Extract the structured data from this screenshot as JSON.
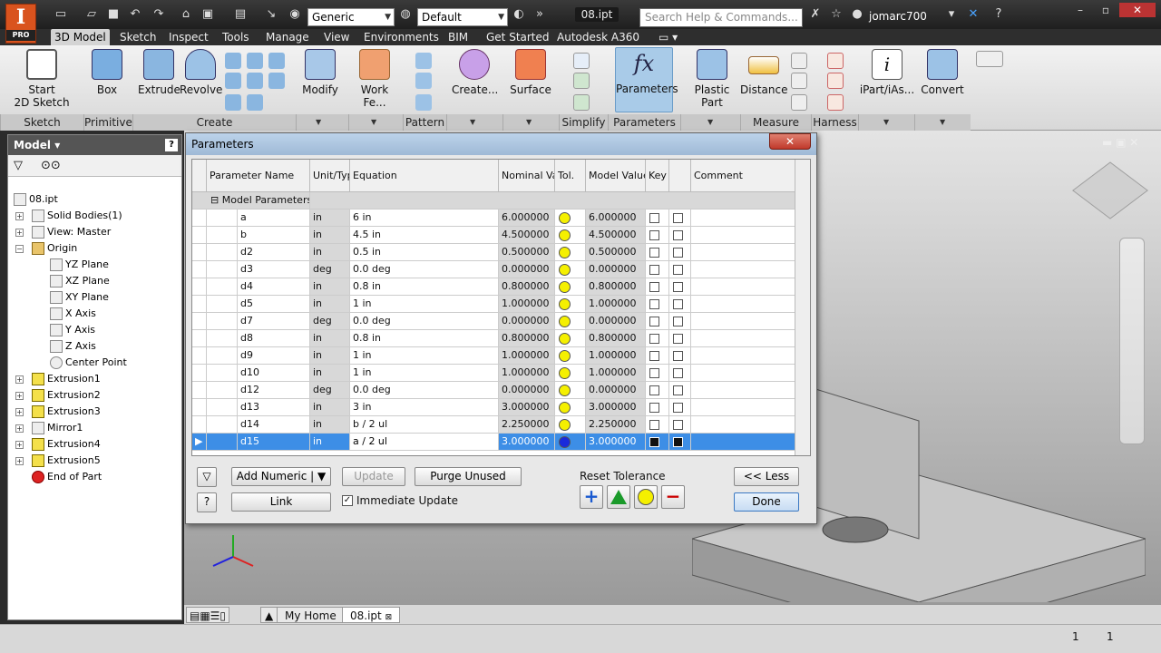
{
  "titlebar": {
    "app_logo_letter": "I",
    "app_logo_sub": "PRO",
    "material_combo": "Generic",
    "appearance_combo": "Default",
    "file_tab": "08.ipt",
    "search_placeholder": "Search Help & Commands...",
    "user": "jomarc700"
  },
  "ribbon_tabs": [
    "3D Model",
    "Sketch",
    "Inspect",
    "Tools",
    "Manage",
    "View",
    "Environments",
    "BIM",
    "Get Started",
    "Autodesk A360"
  ],
  "ribbon": {
    "start_sketch": "Start\n2D Sketch",
    "box": "Box",
    "extrude": "Extrude",
    "revolve": "Revolve",
    "modify": "Modify",
    "work_features": "Work Fe...",
    "create": "Create...",
    "surface": "Surface",
    "parameters": "Parameters",
    "plastic_part": "Plastic Part",
    "distance": "Distance",
    "ipart": "iPart/iAs...",
    "convert": "Convert",
    "groups": [
      "Sketch",
      "Primitives",
      "Create",
      "Pattern",
      "Simplify",
      "Parameters",
      "Measure",
      "Harness"
    ]
  },
  "browser": {
    "title": "Model",
    "items": [
      "08.ipt",
      "Solid Bodies(1)",
      "View: Master",
      "Origin",
      "YZ Plane",
      "XZ Plane",
      "XY Plane",
      "X Axis",
      "Y Axis",
      "Z Axis",
      "Center Point",
      "Extrusion1",
      "Extrusion2",
      "Extrusion3",
      "Mirror1",
      "Extrusion4",
      "Extrusion5",
      "End of Part"
    ]
  },
  "dialog": {
    "title": "Parameters",
    "headers": [
      "Parameter Name",
      "Unit/Typ",
      "Equation",
      "Nominal Valu",
      "Tol.",
      "Model Value",
      "Key",
      "Comment"
    ],
    "group_label": "Model Parameters",
    "rows": [
      {
        "name": "a",
        "unit": "in",
        "eq": "6 in",
        "nominal": "6.000000",
        "model": "6.000000"
      },
      {
        "name": "b",
        "unit": "in",
        "eq": "4.5 in",
        "nominal": "4.500000",
        "model": "4.500000"
      },
      {
        "name": "d2",
        "unit": "in",
        "eq": "0.5 in",
        "nominal": "0.500000",
        "model": "0.500000"
      },
      {
        "name": "d3",
        "unit": "deg",
        "eq": "0.0 deg",
        "nominal": "0.000000",
        "model": "0.000000"
      },
      {
        "name": "d4",
        "unit": "in",
        "eq": "0.8 in",
        "nominal": "0.800000",
        "model": "0.800000"
      },
      {
        "name": "d5",
        "unit": "in",
        "eq": "1 in",
        "nominal": "1.000000",
        "model": "1.000000"
      },
      {
        "name": "d7",
        "unit": "deg",
        "eq": "0.0 deg",
        "nominal": "0.000000",
        "model": "0.000000"
      },
      {
        "name": "d8",
        "unit": "in",
        "eq": "0.8 in",
        "nominal": "0.800000",
        "model": "0.800000"
      },
      {
        "name": "d9",
        "unit": "in",
        "eq": "1 in",
        "nominal": "1.000000",
        "model": "1.000000"
      },
      {
        "name": "d10",
        "unit": "in",
        "eq": "1 in",
        "nominal": "1.000000",
        "model": "1.000000"
      },
      {
        "name": "d12",
        "unit": "deg",
        "eq": "0.0 deg",
        "nominal": "0.000000",
        "model": "0.000000"
      },
      {
        "name": "d13",
        "unit": "in",
        "eq": "3 in",
        "nominal": "3.000000",
        "model": "3.000000"
      },
      {
        "name": "d14",
        "unit": "in",
        "eq": "b / 2 ul",
        "nominal": "2.250000",
        "model": "2.250000"
      },
      {
        "name": "d15",
        "unit": "in",
        "eq": "a / 2 ul",
        "nominal": "3.000000",
        "model": "3.000000"
      }
    ],
    "buttons": {
      "add_numeric": "Add Numeric",
      "update": "Update",
      "purge_unused": "Purge Unused",
      "link": "Link",
      "immediate_update": "Immediate Update",
      "reset_tolerance": "Reset Tolerance",
      "less": "<< Less",
      "done": "Done"
    }
  },
  "doc_tabs": [
    "My Home",
    "08.ipt"
  ],
  "status": {
    "left_num": "1",
    "right_num": "1"
  },
  "colors": {
    "selected_row": "#3d8ee6",
    "tol_dot": "#f5f000",
    "tol_dot_selected": "#1a2adb",
    "brand": "#d9531e"
  }
}
